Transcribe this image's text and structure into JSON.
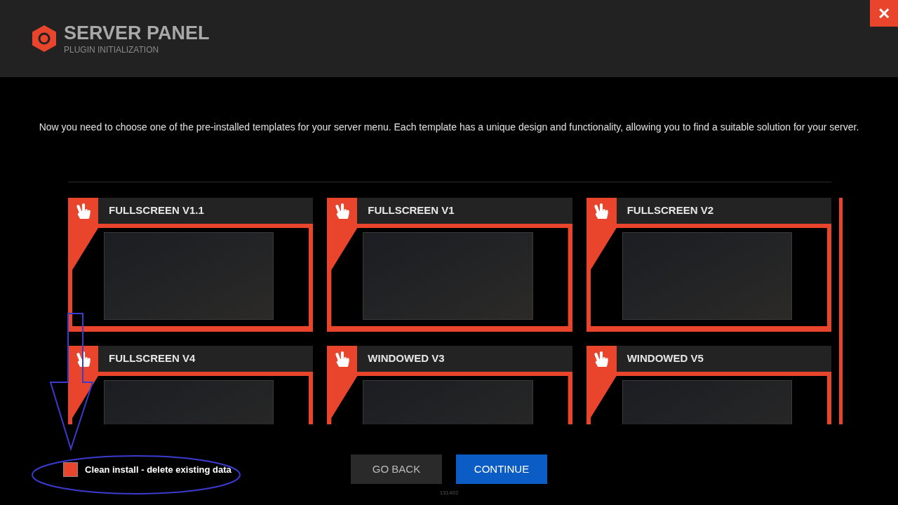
{
  "header": {
    "title": "SERVER PANEL",
    "subtitle": "PLUGIN INITIALIZATION",
    "close": "✕"
  },
  "description": "Now you need to choose one of the pre-installed templates for your server menu. Each template has a unique design and functionality, allowing you to find a suitable solution for your server.",
  "templates": [
    {
      "title": "FULLSCREEN V1.1",
      "selected": false
    },
    {
      "title": "FULLSCREEN V1",
      "selected": false
    },
    {
      "title": "FULLSCREEN V2",
      "selected": false
    },
    {
      "title": "FULLSCREEN V4",
      "selected": false
    },
    {
      "title": "WINDOWED V3",
      "selected": false
    },
    {
      "title": "WINDOWED V5",
      "selected": false
    }
  ],
  "clean_install": {
    "label": "Clean install - delete existing data",
    "checked": true
  },
  "buttons": [
    {
      "label": "GO BACK",
      "kind": "secondary"
    },
    {
      "label": "CONTINUE",
      "kind": "primary"
    }
  ],
  "version": "131402"
}
